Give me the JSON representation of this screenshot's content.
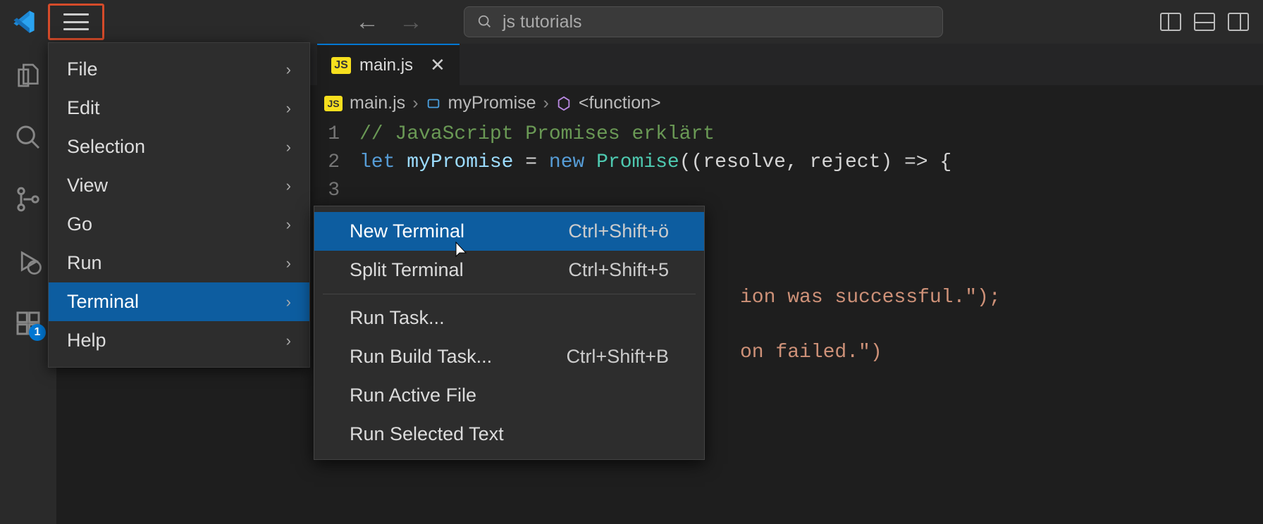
{
  "titlebar": {
    "search_text": "js tutorials"
  },
  "menu": {
    "items": [
      {
        "label": "File"
      },
      {
        "label": "Edit"
      },
      {
        "label": "Selection"
      },
      {
        "label": "View"
      },
      {
        "label": "Go"
      },
      {
        "label": "Run"
      },
      {
        "label": "Terminal"
      },
      {
        "label": "Help"
      }
    ]
  },
  "submenu": {
    "items": [
      {
        "label": "New Terminal",
        "shortcut": "Ctrl+Shift+ö"
      },
      {
        "label": "Split Terminal",
        "shortcut": "Ctrl+Shift+5"
      },
      {
        "label": "Run Task..."
      },
      {
        "label": "Run Build Task...",
        "shortcut": "Ctrl+Shift+B"
      },
      {
        "label": "Run Active File"
      },
      {
        "label": "Run Selected Text"
      }
    ]
  },
  "tab": {
    "icon_text": "JS",
    "filename": "main.js"
  },
  "breadcrumb": {
    "file_icon": "JS",
    "file": "main.js",
    "symbol": "myPromise",
    "inner": "<function>"
  },
  "code": {
    "lines": [
      {
        "n": "1",
        "comment": "// JavaScript Promises erklärt"
      },
      {
        "n": "2",
        "kw": "let",
        "var": "myPromise",
        "op1": " = ",
        "kw2": "new",
        "cls": " Promise",
        "rest": "((resolve, reject) => {"
      },
      {
        "n": "3"
      }
    ],
    "frag_success": "ion was successful.\");",
    "frag_failed": "on failed.\")"
  },
  "activity": {
    "badge": "1"
  }
}
